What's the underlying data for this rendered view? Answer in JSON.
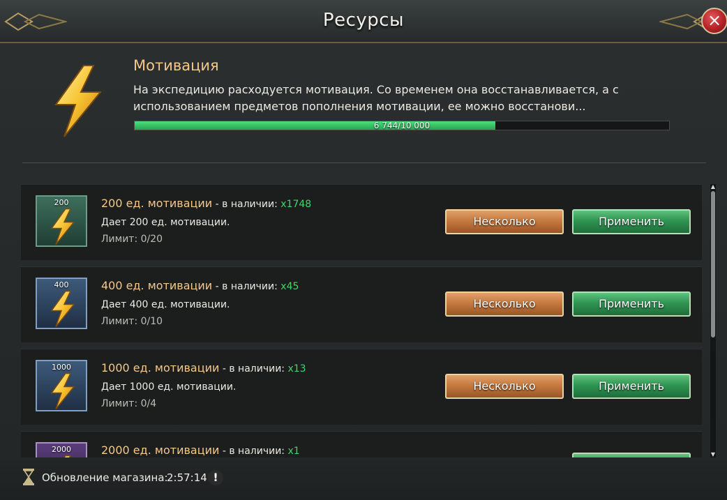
{
  "window": {
    "title": "Ресурсы",
    "close_label": "×"
  },
  "motivation": {
    "title": "Мотивация",
    "description": "На экспедицию расходуется мотивация. Со временем она восстанавливается, а с использованием предметов пополнения мотивации, ее можно восстанови...",
    "progress_text": "6 744/10 000",
    "current": 6744,
    "max": 10000,
    "fraction": 0.6744
  },
  "items": [
    {
      "qty_badge": "200",
      "name": "200 ед. мотивации",
      "sep": " - в наличии: ",
      "count": "x1748",
      "desc": "Дает 200 ед. мотивации.",
      "limit": "Лимит: 0/20",
      "several_label": "Несколько",
      "apply_label": "Применить",
      "tier_color": "#2e5a4a"
    },
    {
      "qty_badge": "400",
      "name": "400 ед. мотивации",
      "sep": " - в наличии: ",
      "count": "x45",
      "desc": "Дает 400 ед. мотивации.",
      "limit": "Лимит: 0/10",
      "several_label": "Несколько",
      "apply_label": "Применить",
      "tier_color": "#2e4560"
    },
    {
      "qty_badge": "1000",
      "name": "1000 ед. мотивации",
      "sep": " - в наличии: ",
      "count": "x13",
      "desc": "Дает 1000 ед. мотивации.",
      "limit": "Лимит: 0/4",
      "several_label": "Несколько",
      "apply_label": "Применить",
      "tier_color": "#2e4560"
    },
    {
      "qty_badge": "2000",
      "name": "2000 ед. мотивации",
      "sep": " - в наличии: ",
      "count": "x1",
      "desc": "",
      "limit": "",
      "several_label": "",
      "apply_label": "",
      "tier_color": "#4a2e60"
    }
  ],
  "footer": {
    "label": "Обновление магазина:",
    "time": "2:57:14",
    "warn": "!"
  },
  "colors": {
    "accent_gold": "#f5c88a",
    "count_green": "#3ed66b",
    "progress_green": "#3fcf70",
    "btn_orange": "#c57a40",
    "btn_green": "#2f9552"
  },
  "icons": [
    "lightning-icon",
    "close-icon",
    "hourglass-icon",
    "warning-icon",
    "scroll-up-icon",
    "scroll-down-icon"
  ]
}
